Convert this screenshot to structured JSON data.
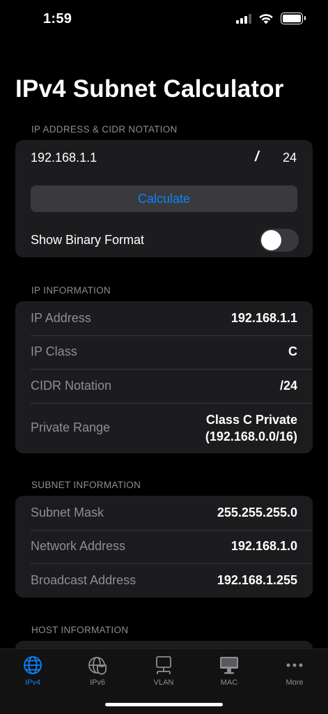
{
  "status": {
    "time": "1:59"
  },
  "title": "IPv4 Subnet Calculator",
  "input_section": {
    "header": "IP ADDRESS & CIDR NOTATION",
    "ip_value": "192.168.1.1",
    "slash": "/",
    "cidr_value": "24",
    "calculate_label": "Calculate",
    "binary_toggle_label": "Show Binary Format",
    "binary_toggle_on": false
  },
  "ip_info": {
    "header": "IP INFORMATION",
    "rows": [
      {
        "label": "IP Address",
        "value": "192.168.1.1"
      },
      {
        "label": "IP Class",
        "value": "C"
      },
      {
        "label": "CIDR Notation",
        "value": "/24"
      },
      {
        "label": "Private Range",
        "value_line1": "Class C Private",
        "value_line2": "(192.168.0.0/16)"
      }
    ]
  },
  "subnet_info": {
    "header": "SUBNET INFORMATION",
    "rows": [
      {
        "label": "Subnet Mask",
        "value": "255.255.255.0"
      },
      {
        "label": "Network Address",
        "value": "192.168.1.0"
      },
      {
        "label": "Broadcast Address",
        "value": "192.168.1.255"
      }
    ]
  },
  "host_info": {
    "header": "HOST INFORMATION"
  },
  "tabs": [
    {
      "label": "IPv4",
      "icon": "globe-icon",
      "active": true
    },
    {
      "label": "IPv6",
      "icon": "globe-shield-icon",
      "active": false
    },
    {
      "label": "VLAN",
      "icon": "monitor-network-icon",
      "active": false
    },
    {
      "label": "MAC",
      "icon": "desktop-icon",
      "active": false
    },
    {
      "label": "More",
      "icon": "ellipsis-icon",
      "active": false
    }
  ],
  "colors": {
    "accent": "#0a84ff",
    "card": "#1c1c1e",
    "background": "#000000",
    "secondary_text": "#8e8e93"
  }
}
